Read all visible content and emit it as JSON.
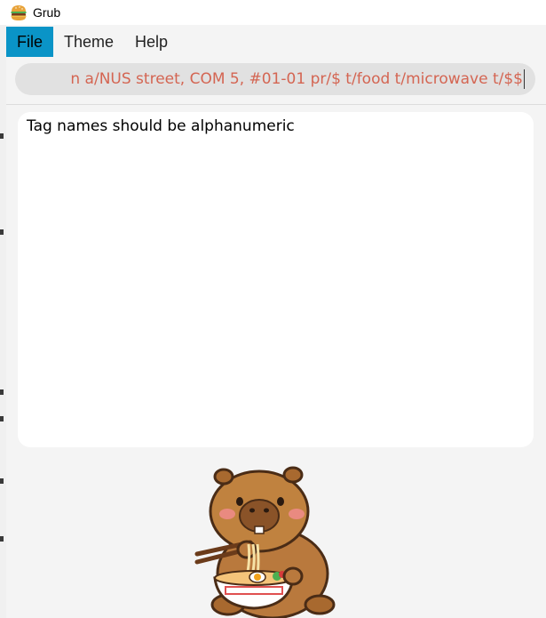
{
  "window": {
    "title": "Grub",
    "icon": "burger-icon"
  },
  "menu": {
    "items": [
      {
        "label": "File",
        "active": true
      },
      {
        "label": "Theme",
        "active": false
      },
      {
        "label": "Help",
        "active": false
      }
    ]
  },
  "command": {
    "value": "n a/NUS street, COM 5, #01-01 pr/$ t/food t/microwave t/$$",
    "text_color": "#d46552"
  },
  "result": {
    "message": "Tag names should be alphanumeric"
  },
  "mascot": {
    "name": "capybara-eating-ramen-image"
  },
  "colors": {
    "menu_active": "#0a94c7",
    "background": "#f4f4f4"
  }
}
